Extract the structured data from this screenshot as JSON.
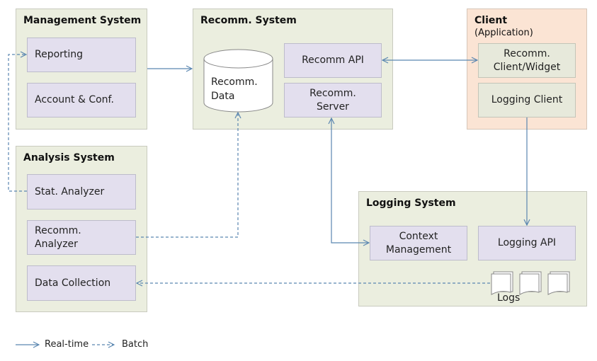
{
  "colors": {
    "arrow": "#5a86b0",
    "panel": "#ebeedf",
    "client_panel": "#fbe4d4",
    "component": "#e3dfee"
  },
  "management": {
    "title": "Management System",
    "items": [
      "Reporting",
      "Account & Conf."
    ]
  },
  "recomm": {
    "title": "Recomm. System",
    "data_line1": "Recomm.",
    "data_line2": "Data",
    "api": "Recomm  API",
    "server_line1": "Recomm.",
    "server_line2": "Server"
  },
  "client": {
    "title": "Client",
    "subtitle": "(Application)",
    "widget_line1": "Recomm.",
    "widget_line2": "Client/Widget",
    "logging": "Logging  Client"
  },
  "analysis": {
    "title": "Analysis System",
    "stat": "Stat.  Analyzer",
    "recomm_line1": "Recomm.",
    "recomm_line2": "Analyzer",
    "collection": "Data  Collection"
  },
  "logging": {
    "title": "Logging System",
    "context_line1": "Context",
    "context_line2": "Management",
    "api": "Logging  API",
    "logs": "Logs"
  },
  "legend": {
    "realtime": "Real-time",
    "batch": "Batch"
  }
}
